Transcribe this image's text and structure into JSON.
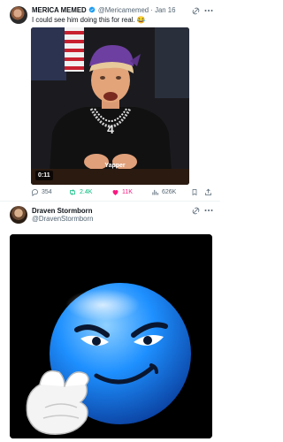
{
  "tweets": [
    {
      "author_name": "MERICA MEMED",
      "handle": "@Mericamemed",
      "separator": "·",
      "date": "Jan 16",
      "meta_line": "@Mericamemed · Jan 16",
      "text": "I could see him doing this for real. 😂",
      "media_duration": "0:11",
      "media_overlay_text": "Yapper",
      "verified": true,
      "actions": {
        "replies": "354",
        "retweets": "2.4K",
        "likes": "11K",
        "views": "626K"
      }
    },
    {
      "author_name": "Draven Stormborn",
      "handle": "@DravenStormborn"
    }
  ],
  "icons": {
    "grok": "grok-icon",
    "more": "more-icon",
    "reply": "reply-icon",
    "retweet": "retweet-icon",
    "like": "heart-icon",
    "views": "views-icon",
    "share": "share-icon",
    "verified": "verified-badge-icon"
  },
  "colors": {
    "accent": "#1d9bf0",
    "retweet": "#00ba7c",
    "like": "#f91880",
    "muted": "#536471",
    "emoji_blue": "#1e90ff"
  }
}
